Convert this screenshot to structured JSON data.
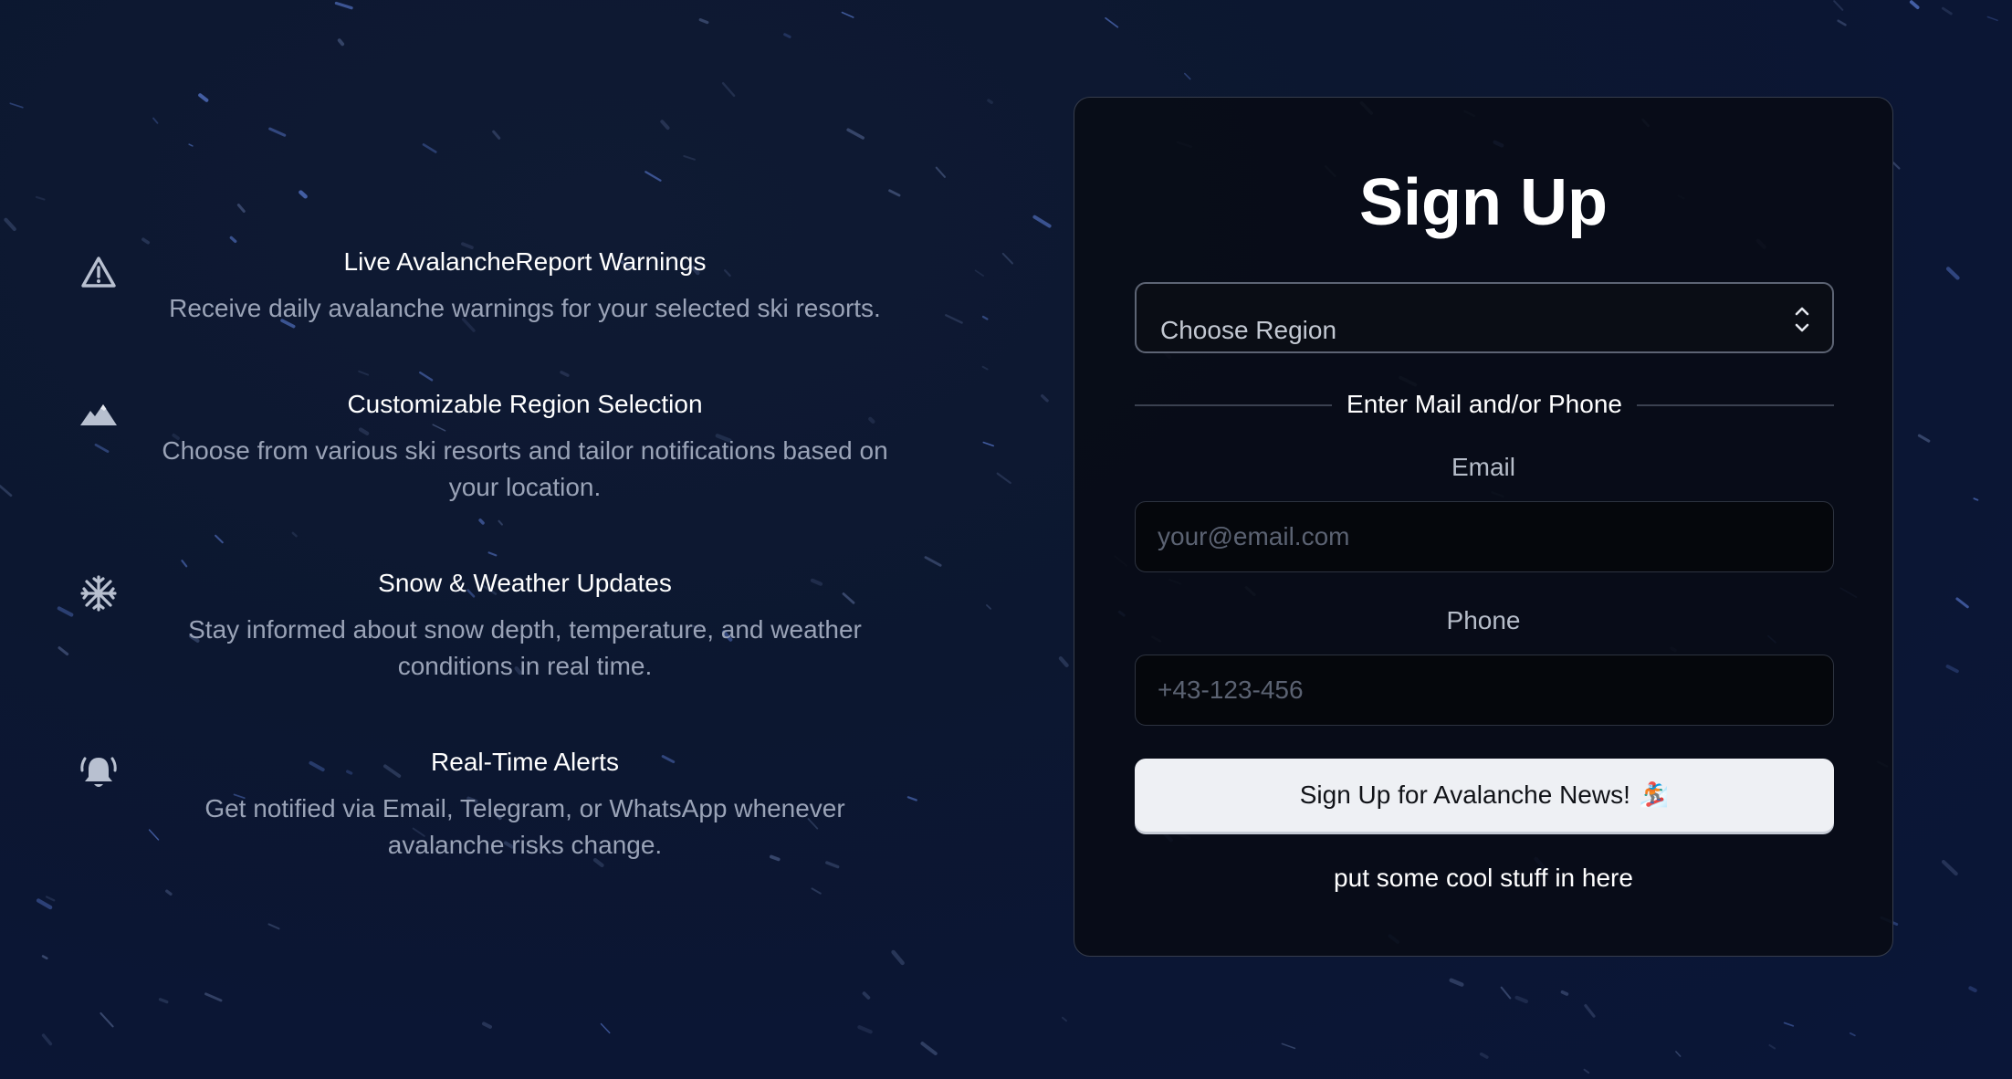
{
  "features": [
    {
      "icon": "warning-triangle-icon",
      "title": "Live AvalancheReport Warnings",
      "description": "Receive daily avalanche warnings for your selected ski resorts."
    },
    {
      "icon": "mountain-icon",
      "title": "Customizable Region Selection",
      "description": "Choose from various ski resorts and tailor notifications based on your location."
    },
    {
      "icon": "snowflake-icon",
      "title": "Snow & Weather Updates",
      "description": "Stay informed about snow depth, temperature, and weather conditions in real time."
    },
    {
      "icon": "bell-ringing-icon",
      "title": "Real-Time Alerts",
      "description": "Get notified via Email, Telegram, or WhatsApp whenever avalanche risks change."
    }
  ],
  "signup": {
    "title": "Sign Up",
    "region_select": {
      "value": "Choose Region"
    },
    "divider_label": "Enter Mail and/or Phone",
    "email": {
      "label": "Email",
      "placeholder": "your@email.com",
      "value": ""
    },
    "phone": {
      "label": "Phone",
      "placeholder": "+43-123-456",
      "value": ""
    },
    "submit_label": "Sign Up for Avalanche News!",
    "submit_emoji": "🏂",
    "footer_text": "put some cool stuff in here"
  },
  "colors": {
    "background": "#0c1730",
    "card_background": "#080b14",
    "card_border": "#363d4c",
    "muted_text": "#9aa3b7",
    "icon": "#b8c0d0",
    "button_background": "#eef0f4"
  }
}
